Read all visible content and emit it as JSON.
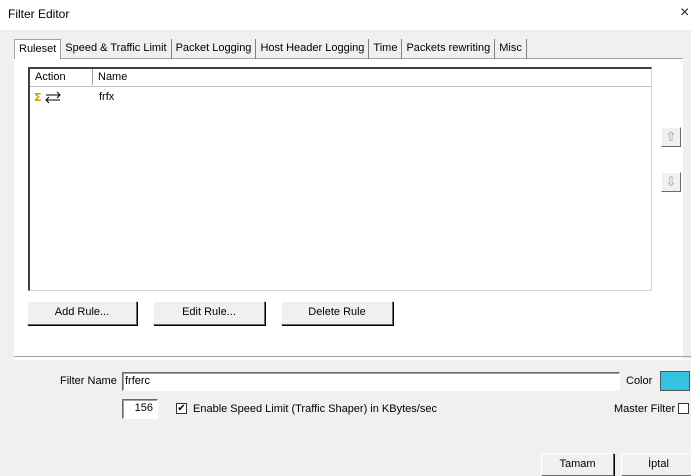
{
  "window": {
    "title": "Filter Editor",
    "close_glyph": "×"
  },
  "tabs": [
    {
      "label": "Ruleset",
      "active": true
    },
    {
      "label": "Speed & Traffic Limit",
      "active": false
    },
    {
      "label": "Packet Logging",
      "active": false
    },
    {
      "label": "Host Header Logging",
      "active": false
    },
    {
      "label": "Time",
      "active": false
    },
    {
      "label": "Packets rewriting",
      "active": false
    },
    {
      "label": "Misc",
      "active": false
    }
  ],
  "rules_list": {
    "columns": [
      "Action",
      "Name"
    ],
    "rows": [
      {
        "action_icon": "sigma-exchange-icon",
        "name": "frfx"
      }
    ]
  },
  "buttons": {
    "add_rule": "Add Rule...",
    "edit_rule": "Edit Rule...",
    "delete_rule": "Delete Rule",
    "ok": "Tamam",
    "cancel": "İptal"
  },
  "filter": {
    "name_label": "Filter Name",
    "name_value": "frferc",
    "color_label": "Color",
    "color_value": "#33c3e0",
    "speed_value": "156",
    "speed_checkbox_label": "Enable Speed Limit (Traffic Shaper) in KBytes/sec",
    "speed_enabled": true,
    "master_filter_label": "Master Filter",
    "master_filter_checked": false
  }
}
